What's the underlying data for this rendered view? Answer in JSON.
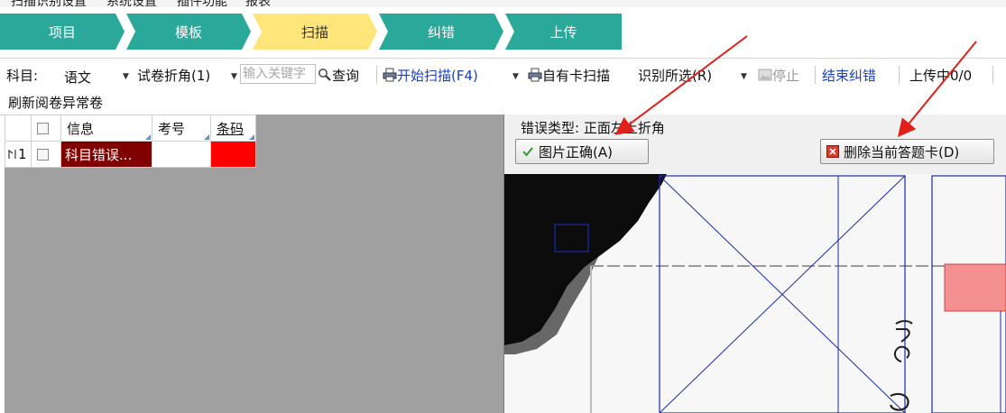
{
  "menu": {
    "items": [
      "扫描识别设置",
      "系统设置",
      "插件功能",
      "报表"
    ]
  },
  "steps": [
    {
      "label": "项目",
      "active": false
    },
    {
      "label": "模板",
      "active": false
    },
    {
      "label": "扫描",
      "active": true
    },
    {
      "label": "纠错",
      "active": false
    },
    {
      "label": "上传",
      "active": false
    }
  ],
  "toolbar": {
    "subject_label": "科目:",
    "subject_value": "语文",
    "fold_filter": "试卷折角(1)",
    "keyword_placeholder": "输入关键字",
    "query": "查询",
    "start_scan": "开始扫描(F4)",
    "own_card_scan": "自有卡扫描",
    "recognize_selected": "识别所选(R)",
    "stop": "停止",
    "finish_correction": "结束纠错",
    "upload_status": "上传中0/0",
    "refresh_abnormal": "刷新阅卷异常卷"
  },
  "grid": {
    "headers": [
      "信息",
      "考号",
      "条码"
    ],
    "rows": [
      {
        "index": "1",
        "info": "科目错误...",
        "exam_no": "",
        "barcode": ""
      }
    ]
  },
  "detail": {
    "error_type": "错误类型: 正面左上折角",
    "btn_correct": "图片正确(A)",
    "btn_delete": "删除当前答题卡(D)"
  },
  "colors": {
    "step_teal": "#2aa89a",
    "step_active": "#ffe57a",
    "error_cell": "#800000",
    "barcode_cell": "#ff0000",
    "annotation_arrow": "#e0201a"
  }
}
